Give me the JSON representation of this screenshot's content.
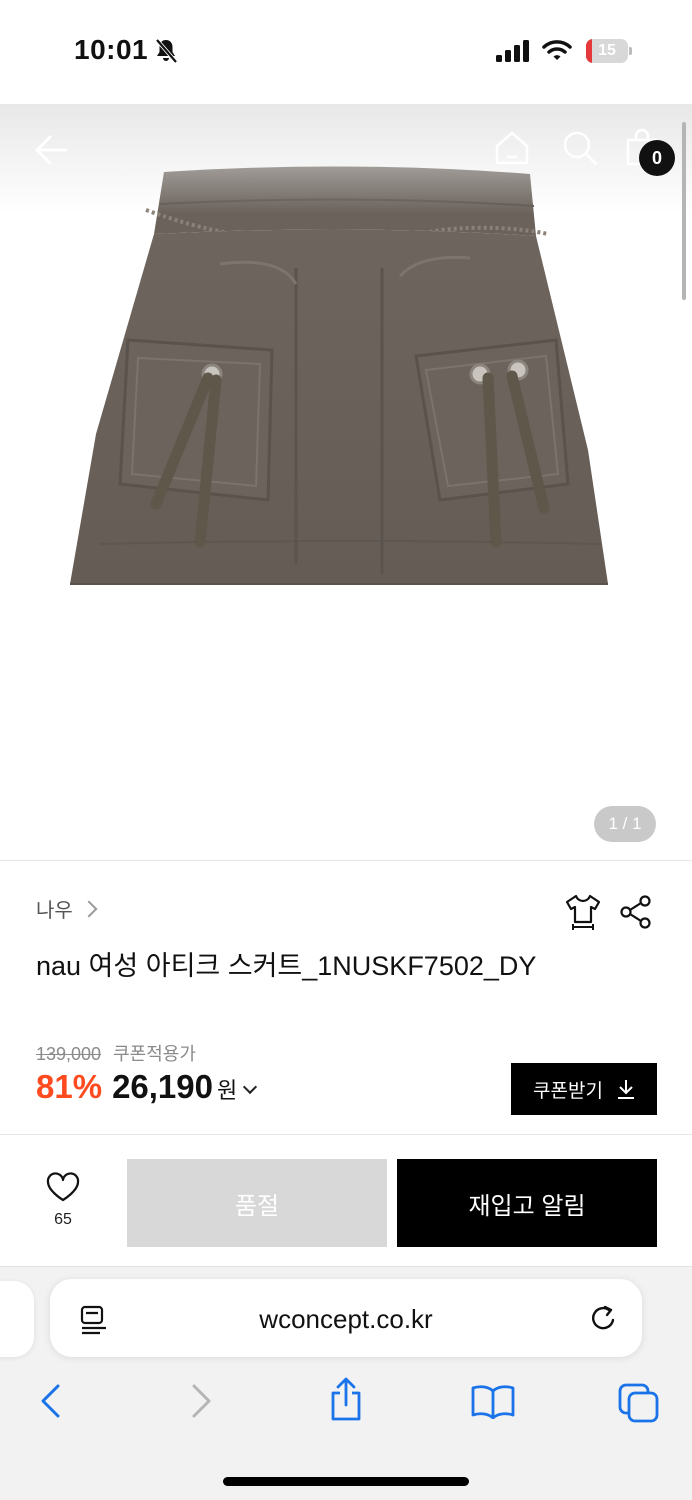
{
  "status_bar": {
    "time": "10:01",
    "battery": "15",
    "battery_level": 0.15,
    "battery_color": "#e5383b"
  },
  "header": {
    "cart_count": "0"
  },
  "gallery": {
    "pager": "1 / 1"
  },
  "product": {
    "brand": "나우",
    "title": "nau 여성 아티크 스커트_1NUSKF7502_DY",
    "original_price": "139,000",
    "coupon_note": "쿠폰적용가",
    "discount": "81%",
    "price": "26,190",
    "currency": "원"
  },
  "coupon_button": {
    "label": "쿠폰받기"
  },
  "actions": {
    "like_count": "65",
    "soldout_label": "품절",
    "restock_label": "재입고 알림"
  },
  "browser": {
    "url": "wconcept.co.kr"
  },
  "colors": {
    "discount": "#ff4b1f",
    "soldout_bg": "#d8d8d8",
    "primary": "#000000"
  }
}
